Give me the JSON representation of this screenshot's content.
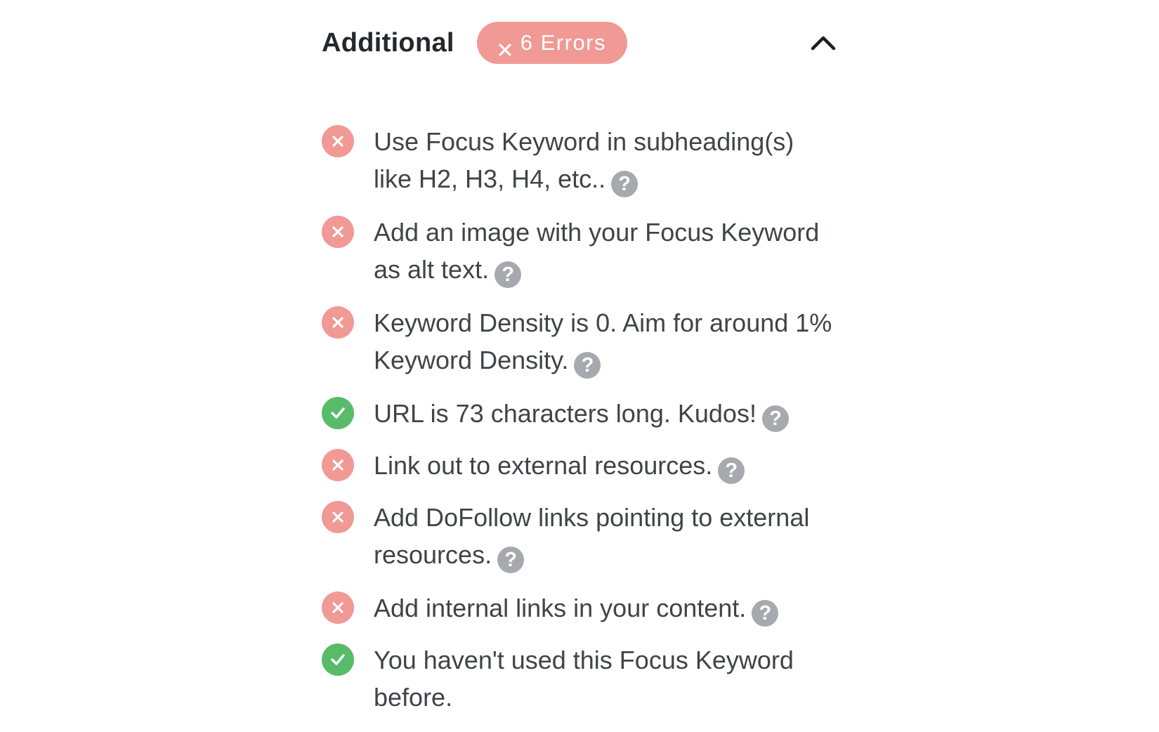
{
  "section": {
    "title": "Additional",
    "badge": {
      "icon": "close-icon",
      "label": "6 Errors",
      "color": "#f09995"
    },
    "collapse_icon": "chevron-up-icon"
  },
  "colors": {
    "fail": "#f09995",
    "pass": "#58bb6a",
    "help": "#a6a9ad",
    "text": "#3f4449"
  },
  "help_glyph": "?",
  "checks": [
    {
      "status": "fail",
      "text": "Use Focus Keyword in subheading(s) like H2, H3, H4, etc.."
    },
    {
      "status": "fail",
      "text": "Add an image with your Focus Keyword as alt text."
    },
    {
      "status": "fail",
      "text": "Keyword Density is 0. Aim for around 1% Keyword Density."
    },
    {
      "status": "pass",
      "text": "URL is 73 characters long. Kudos!"
    },
    {
      "status": "fail",
      "text": "Link out to external resources."
    },
    {
      "status": "fail",
      "text": "Add DoFollow links pointing to external resources."
    },
    {
      "status": "fail",
      "text": "Add internal links in your content."
    },
    {
      "status": "pass",
      "text": "You haven't used this Focus Keyword before."
    }
  ]
}
